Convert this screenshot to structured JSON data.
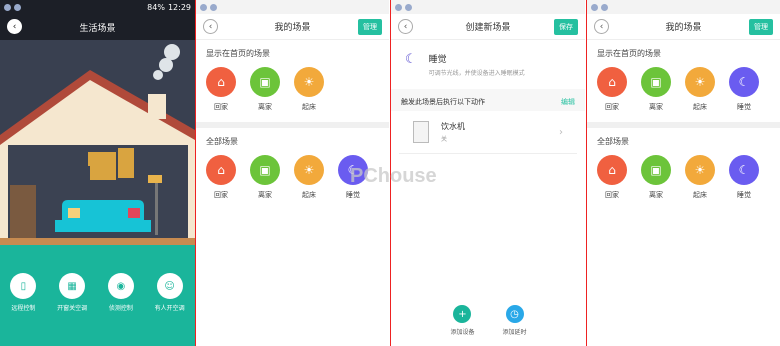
{
  "colors": {
    "accent": "#25c0a0",
    "orange": "#f06040",
    "green": "#6cc43a",
    "yellow": "#f2a93b",
    "purple": "#6a5cf0"
  },
  "status": {
    "time": "12:29",
    "battery": "84%"
  },
  "p1": {
    "title": "生活场景",
    "items": [
      {
        "label": "远程控制",
        "icon": "phone-icon"
      },
      {
        "label": "开窗关空调",
        "icon": "window-icon"
      },
      {
        "label": "侦测控制",
        "icon": "sensor-icon"
      },
      {
        "label": "有人开空调",
        "icon": "person-icon"
      }
    ]
  },
  "p2": {
    "title": "我的场景",
    "manage": "管理",
    "home_section": "显示在首页的场景",
    "home_scenes": [
      "回家",
      "离家",
      "起床"
    ],
    "all_section": "全部场景",
    "all_scenes": [
      "回家",
      "离家",
      "起床",
      "睡觉"
    ]
  },
  "p3": {
    "title": "创建新场景",
    "save": "保存",
    "scene_name": "睡觉",
    "scene_desc": "可调节光线，并使设备进入睡眠模式",
    "action_header": "触发此场景后执行以下动作",
    "edit": "编辑",
    "device_name": "饮水机",
    "device_state": "关",
    "add_device": "添加设备",
    "add_delay": "添加延时"
  },
  "p4": {
    "title": "我的场景",
    "manage": "管理",
    "home_section": "显示在首页的场景",
    "home_scenes": [
      "回家",
      "离家",
      "起床",
      "睡觉"
    ],
    "all_section": "全部场景",
    "all_scenes": [
      "回家",
      "离家",
      "起床",
      "睡觉"
    ]
  },
  "watermark": "PChouse"
}
